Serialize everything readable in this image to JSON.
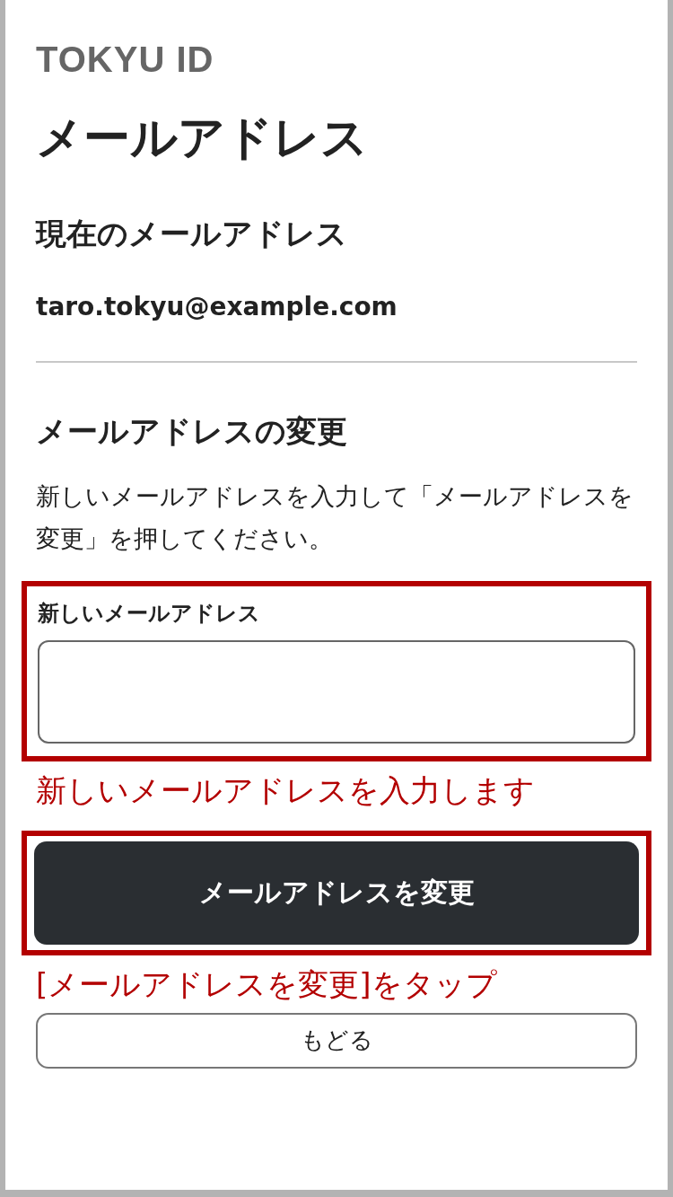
{
  "logo": "TOKYU ID",
  "title": "メールアドレス",
  "current": {
    "heading": "現在のメールアドレス",
    "email": "taro.tokyu@example.com"
  },
  "change": {
    "heading": "メールアドレスの変更",
    "instructions": "新しいメールアドレスを入力して「メールアドレスを変更」を押してください。",
    "field": {
      "label": "新しいメールアドレス",
      "highlighted": true
    },
    "field_note": "新しいメールアドレスを入力します",
    "submit_button": {
      "label": "メールアドレスを変更",
      "highlighted": true
    },
    "button_note": "[メールアドレスを変更]をタップ",
    "back_button": "もどる"
  }
}
